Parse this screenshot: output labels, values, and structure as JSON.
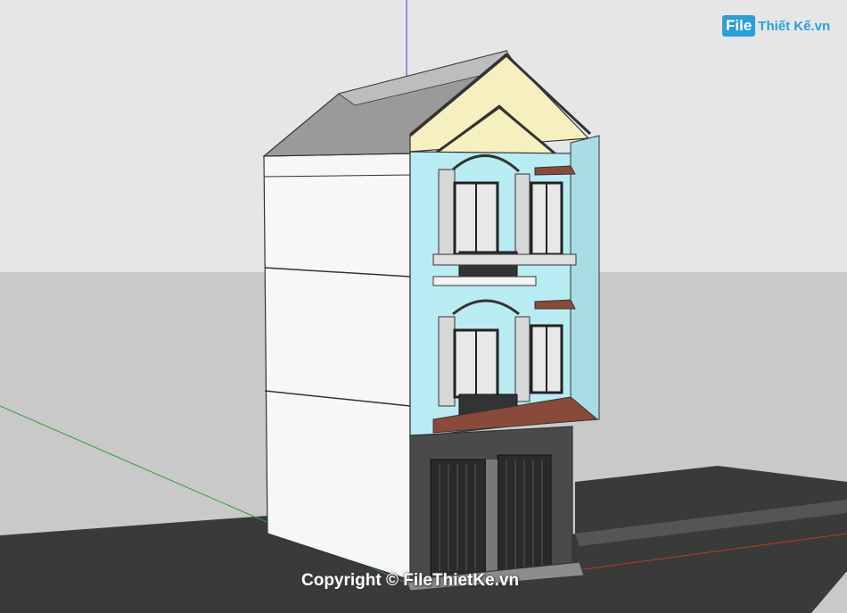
{
  "watermark": {
    "logo_badge": "File",
    "logo_text": "Thiết Kế.vn",
    "copyright": "Copyright © FileThietKe.vn"
  },
  "colors": {
    "sky": "#e6e6e8",
    "ground": "#c9c9c9",
    "road": "#3a3a3a",
    "wall": "#f7f7f7",
    "facade": "#b9ecf2",
    "gable": "#f6efbf",
    "roof": "#8f8f8f",
    "door": "#2a2a2a",
    "balcony_floor": "#8a4a3a",
    "logo_blue": "#2a9fd8"
  }
}
